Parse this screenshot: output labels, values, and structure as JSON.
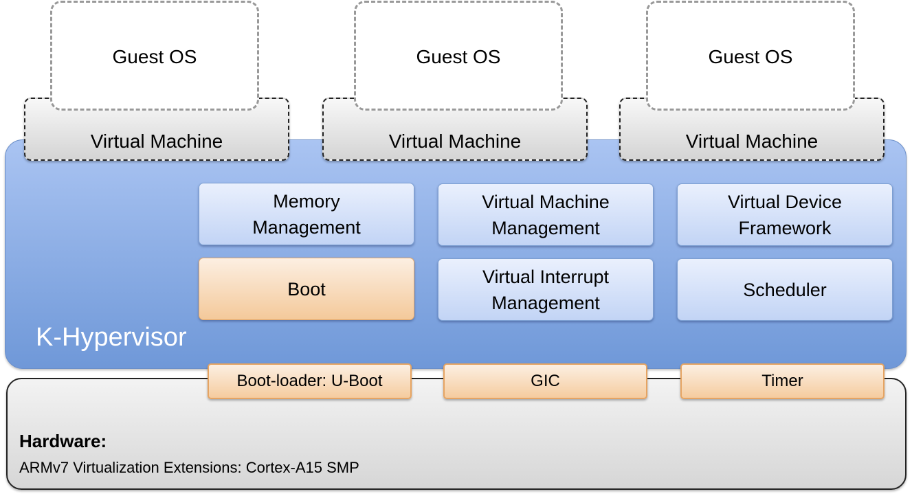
{
  "guest_os": [
    {
      "label": "Guest OS"
    },
    {
      "label": "Guest OS"
    },
    {
      "label": "Guest OS"
    }
  ],
  "virtual_machines": [
    {
      "label": "Virtual Machine"
    },
    {
      "label": "Virtual Machine"
    },
    {
      "label": "Virtual Machine"
    }
  ],
  "hypervisor": {
    "label": "K-Hypervisor",
    "color": "#7a9fdc",
    "modules": [
      {
        "line1": "Memory",
        "line2": "Management",
        "style": "blue"
      },
      {
        "line1": "Virtual Machine",
        "line2": "Management",
        "style": "blue"
      },
      {
        "line1": "Virtual Device",
        "line2": "Framework",
        "style": "blue"
      },
      {
        "line1": "Boot",
        "line2": "",
        "style": "orange"
      },
      {
        "line1": "Virtual Interrupt",
        "line2": "Management",
        "style": "blue"
      },
      {
        "line1": "Scheduler",
        "line2": "",
        "style": "blue"
      }
    ]
  },
  "hardware_interfaces": [
    {
      "label": "Boot-loader: U-Boot"
    },
    {
      "label": "GIC"
    },
    {
      "label": "Timer"
    }
  ],
  "hardware": {
    "title": "Hardware:",
    "description": "ARMv7 Virtualization Extensions: Cortex-A15 SMP"
  },
  "colors": {
    "module_blue": "#c9d9f6",
    "module_orange": "#f6d3ad",
    "hardware_gray": "#e2e2e2"
  }
}
